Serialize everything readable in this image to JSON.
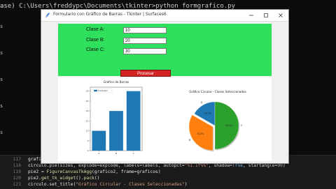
{
  "terminal": {
    "prompt_prefix": "ase) C:\\Users\\freddypc\\Documents\\tkinter>",
    "command": "python formgrafico.py",
    "left_fragments": [
      "s",
      "s",
      "s",
      "s",
      "s"
    ]
  },
  "window": {
    "title": "Formulario con Gráfico de Barras - Tkinter | Surfaces6",
    "minimize_glyph": "—",
    "maximize_glyph": "☐",
    "close_glyph": "✕"
  },
  "form": {
    "fields": [
      {
        "label": "Clase A:",
        "value": "10"
      },
      {
        "label": "Clase B:",
        "value": "20"
      },
      {
        "label": "Clase C:",
        "value": "30"
      }
    ],
    "button_label": "Procesar",
    "background_color": "#2ee05c",
    "button_color": "#d32424"
  },
  "chart_data": [
    {
      "type": "bar",
      "title": "Gráfico de Barras",
      "legend": [
        "Cantidad"
      ],
      "categories": [
        "A",
        "B",
        "C"
      ],
      "values": [
        10,
        20,
        30
      ],
      "yticks": [
        "0",
        "5",
        "10",
        "15",
        "20",
        "25",
        "30"
      ],
      "ylim": [
        0,
        32
      ],
      "color": "#1f77b4"
    },
    {
      "type": "pie",
      "title": "Gráfico Circular - Clases Seleccionadas",
      "labels": [
        "A",
        "B",
        "C"
      ],
      "values": [
        16.7,
        33.3,
        50.0
      ],
      "percent_labels": [
        "16.7%",
        "33.3%",
        "50.0%"
      ],
      "colors": [
        "#1f77b4",
        "#ff7f0e",
        "#2ca02c"
      ],
      "explode": [
        0,
        0.1,
        0
      ],
      "startangle": 90
    }
  ],
  "editor": {
    "lines": [
      {
        "num": "",
        "parts": [
          [
            "code",
            "grafico2."
          ],
          [
            "fn",
            "add_subplot"
          ],
          [
            "code",
            "("
          ],
          [
            "num",
            "111"
          ],
          [
            "code",
            ")"
          ]
        ]
      },
      {
        "num": "118",
        "parts": [
          [
            "code",
            "circulo.pie(sizes, explode=explode, labels=labels, autopct="
          ],
          [
            "str",
            "\"%1.1f%%\""
          ],
          [
            "code",
            ", shadow="
          ],
          [
            "kw",
            "True"
          ],
          [
            "code",
            ", startangle="
          ],
          [
            "num",
            "90"
          ],
          [
            "code",
            ")"
          ]
        ]
      },
      {
        "num": "119",
        "parts": [
          [
            "code",
            "pie2 = "
          ],
          [
            "fn",
            "FigureCanvasTkAgg"
          ],
          [
            "code",
            "(grafico2, frame=graficos)"
          ]
        ]
      },
      {
        "num": "120",
        "parts": [
          [
            "code",
            "pie2."
          ],
          [
            "fn",
            "get_tk_widget"
          ],
          [
            "code",
            "()."
          ],
          [
            "fn",
            "pack"
          ],
          [
            "code",
            "()"
          ]
        ]
      },
      {
        "num": "121",
        "parts": [
          [
            "code",
            "circulo.set_title("
          ],
          [
            "str",
            "\"Gráfico Circular - Clases Seleccionadas\""
          ],
          [
            "code",
            ")"
          ]
        ]
      }
    ],
    "first_line_num": "117"
  }
}
